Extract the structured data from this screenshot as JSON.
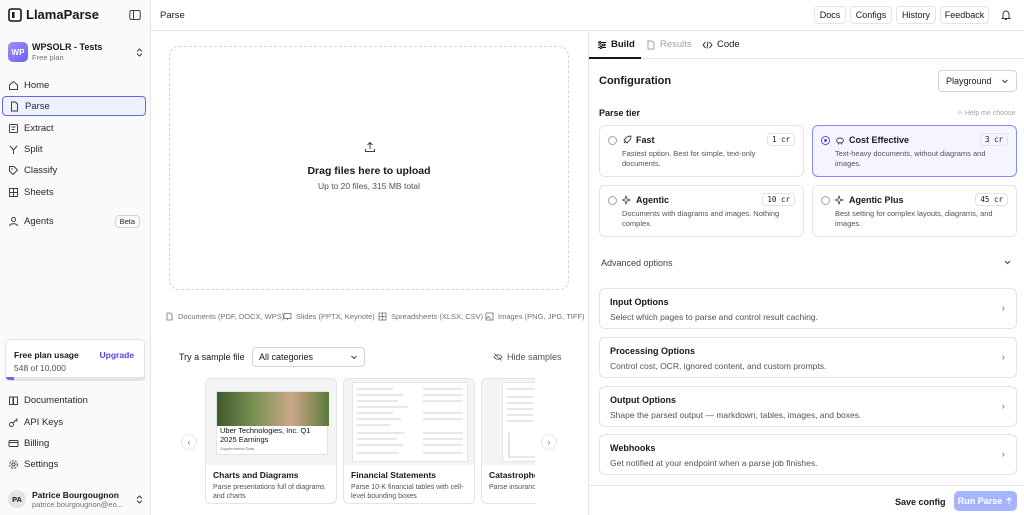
{
  "sidebar": {
    "brand": "LlamaParse",
    "workspace": {
      "initials": "WP",
      "name": "WPSOLR - Tests",
      "plan": "Free plan"
    },
    "nav": [
      {
        "label": "Home",
        "icon": "home-icon"
      },
      {
        "label": "Parse",
        "icon": "file-icon"
      },
      {
        "label": "Extract",
        "icon": "extract-icon"
      },
      {
        "label": "Split",
        "icon": "split-icon"
      },
      {
        "label": "Classify",
        "icon": "tag-icon"
      },
      {
        "label": "Sheets",
        "icon": "sheet-icon"
      },
      {
        "label": "Agents",
        "icon": "agents-icon",
        "badge": "Beta"
      }
    ],
    "usage": {
      "title": "Free plan usage",
      "upgrade": "Upgrade",
      "count": "548 of 10,000",
      "used": 548,
      "total": 10000
    },
    "bottom_nav": [
      {
        "label": "Documentation",
        "icon": "book-icon"
      },
      {
        "label": "API Keys",
        "icon": "key-icon"
      },
      {
        "label": "Billing",
        "icon": "card-icon"
      },
      {
        "label": "Settings",
        "icon": "gear-icon"
      }
    ],
    "user": {
      "initials": "PA",
      "name": "Patrice Bourgougnon",
      "email": "patrice.bourgougnon@eo..."
    }
  },
  "topbar": {
    "crumb": "Parse",
    "buttons": [
      "Docs",
      "Configs",
      "History",
      "Feedback"
    ]
  },
  "upload": {
    "title": "Drag files here to upload",
    "subtitle": "Up to 20 files, 315 MB total",
    "formats": [
      "Documents (PDF, DOCX, WPS)",
      "Slides (PPTX, Keynote)",
      "Spreadsheets (XLSX, CSV)",
      "Images (PNG, JPG, TIFF)"
    ]
  },
  "samples": {
    "label": "Try a sample file",
    "category": "All categories",
    "hide": "Hide samples",
    "cards": [
      {
        "title": "Charts and Diagrams",
        "desc": "Parse presentations full of diagrams and charts",
        "thumb_title": "Uber Technologies, Inc. Q1 2025 Earnings",
        "thumb_sub": "Supplemental Data"
      },
      {
        "title": "Financial Statements",
        "desc": "Parse 10-K financial tables with cell-level bounding boxes"
      },
      {
        "title": "Catastrophe",
        "desc": "Parse insurance ranked event t"
      }
    ]
  },
  "panel": {
    "tabs": [
      "Build",
      "Results",
      "Code"
    ],
    "config_title": "Configuration",
    "mode": "Playground",
    "tier_label": "Parse tier",
    "help": "Help me choose",
    "tiers": [
      {
        "name": "Fast",
        "credits": "1 cr",
        "desc": "Fastest option. Best for simple, text-only documents.",
        "selected": false
      },
      {
        "name": "Cost Effective",
        "credits": "3 cr",
        "desc": "Text-heavy documents, without diagrams and images.",
        "selected": true
      },
      {
        "name": "Agentic",
        "credits": "10 cr",
        "desc": "Documents with diagrams and images. Nothing complex.",
        "selected": false
      },
      {
        "name": "Agentic Plus",
        "credits": "45 cr",
        "desc": "Best setting for complex layouts, diagrams, and images.",
        "selected": false
      }
    ],
    "advanced": "Advanced options",
    "options": [
      {
        "title": "Input Options",
        "desc": "Select which pages to parse and control result caching."
      },
      {
        "title": "Processing Options",
        "desc": "Control cost, OCR, ignored content, and custom prompts."
      },
      {
        "title": "Output Options",
        "desc": "Shape the parsed output — markdown, tables, images, and boxes."
      },
      {
        "title": "Webhooks",
        "desc": "Get notified at your endpoint when a parse job finishes."
      }
    ],
    "save": "Save config",
    "run": "Run Parse"
  },
  "colors": {
    "accent": "#6366f1",
    "run_disabled": "#a5b4fc"
  }
}
